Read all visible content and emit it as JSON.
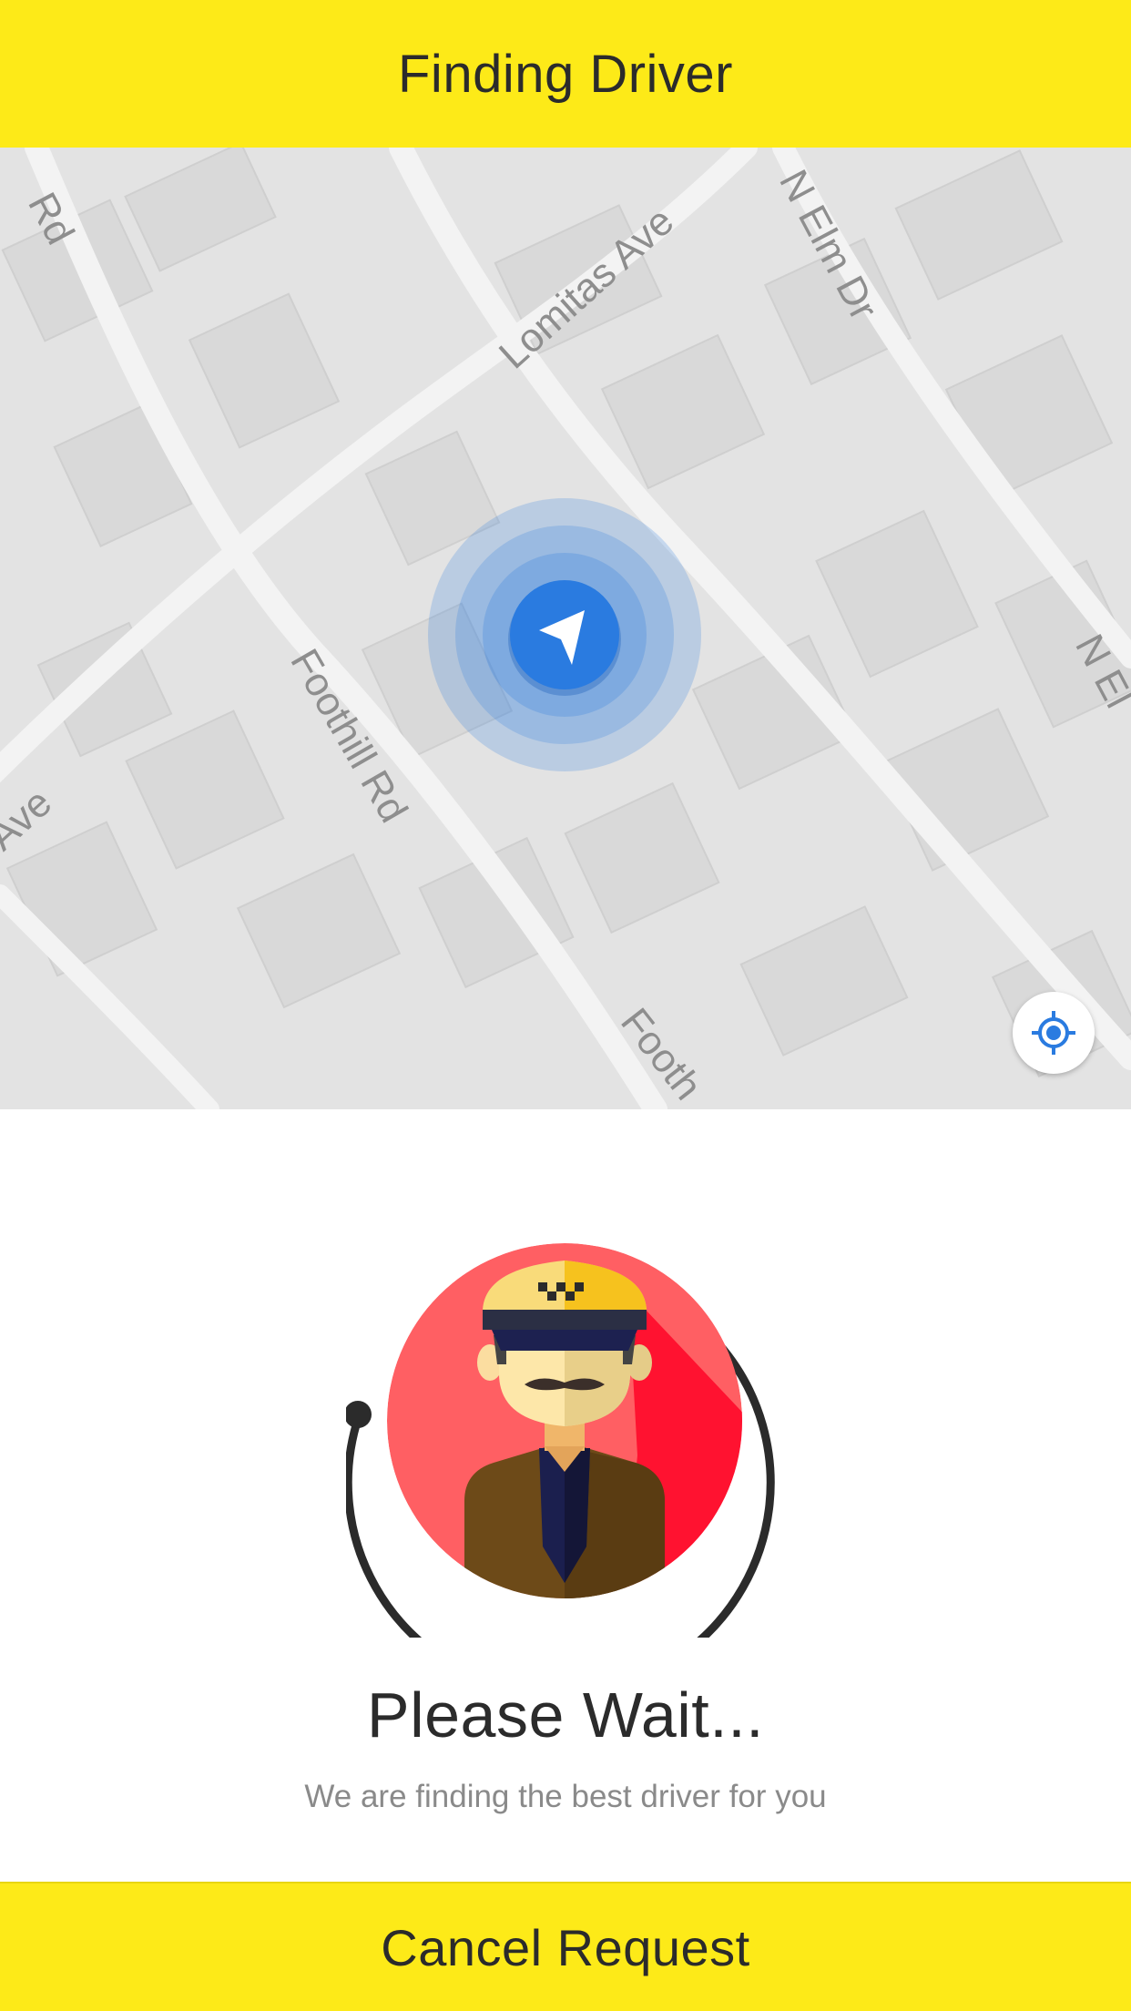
{
  "header": {
    "title": "Finding Driver"
  },
  "map": {
    "street_labels": {
      "rd_top_left": "Rd",
      "lomitas_ave": "Lomitas Ave",
      "n_elm_dr": "N Elm Dr",
      "n_elm_edge": "N El",
      "ave_left": "s Ave",
      "foothill_rd": "Foothill Rd",
      "foothill_bottom": "Footh"
    },
    "locate_button_icon": "crosshair-icon",
    "user_marker_icon": "navigation-arrow-icon"
  },
  "status": {
    "title": "Please Wait...",
    "subtitle": "We are finding the best driver for you"
  },
  "actions": {
    "cancel_label": "Cancel Request"
  },
  "colors": {
    "accent_yellow": "#FDEA18",
    "map_background": "#e3e3e3",
    "marker_blue": "#2A7BE0",
    "avatar_red": "#FF5F63",
    "text_dark": "#2b2b2b",
    "text_muted": "#8a8a8a"
  }
}
